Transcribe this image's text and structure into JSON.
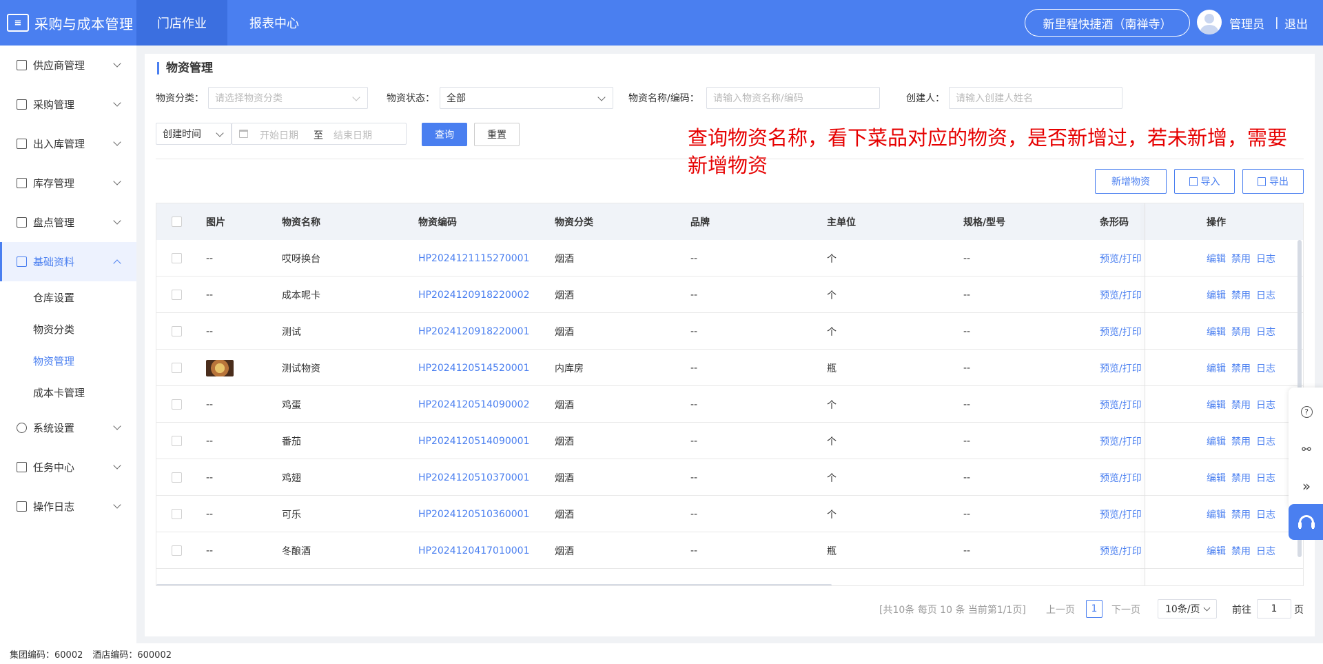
{
  "topbar": {
    "brand_icon": "ticket-logo-icon",
    "brand_title": "采购与成本管理",
    "nav": [
      "门店作业",
      "报表中心"
    ],
    "hotel": "新里程快捷酒（南禅寺）",
    "user": "管理员",
    "separator": "|",
    "logout": "退出",
    "color": "#4a7ff0"
  },
  "sidebar": {
    "items": [
      {
        "label": "供应商管理",
        "icon": "supplier-icon"
      },
      {
        "label": "采购管理",
        "icon": "purchase-icon"
      },
      {
        "label": "出入库管理",
        "icon": "stock-in-out-icon"
      },
      {
        "label": "库存管理",
        "icon": "inventory-icon"
      },
      {
        "label": "盘点管理",
        "icon": "stocktake-icon"
      },
      {
        "label": "基础资料",
        "icon": "basic-data-icon"
      },
      {
        "label": "系统设置",
        "icon": "settings-icon"
      },
      {
        "label": "任务中心",
        "icon": "task-icon"
      },
      {
        "label": "操作日志",
        "icon": "log-icon"
      }
    ],
    "submenu": [
      "仓库设置",
      "物资分类",
      "物资管理",
      "成本卡管理"
    ]
  },
  "page": {
    "title": "物资管理",
    "filters": {
      "category_label": "物资分类：",
      "category_placeholder": "请选择物资分类",
      "status_label": "物资状态：",
      "status_value": "全部",
      "name_label": "物资名称/编码：",
      "name_placeholder": "请输入物资名称/编码",
      "creator_label": "创建人：",
      "creator_placeholder": "请输入创建人姓名",
      "time_type": "创建时间",
      "date_start": "开始日期",
      "date_to": "至",
      "date_end": "结束日期",
      "query": "查询",
      "reset": "重置"
    },
    "annotation": "查询物资名称，看下菜品对应的物资，是否新增过，若未新增，需要新增物资",
    "toolbar": {
      "add": "新增物资",
      "import": "导入",
      "export": "导出"
    }
  },
  "table": {
    "columns": [
      "图片",
      "物资名称",
      "物资编码",
      "物资分类",
      "品牌",
      "主单位",
      "规格/型号",
      "条形码",
      "操作"
    ],
    "rows": [
      {
        "img": "--",
        "name": "哎呀换台",
        "code": "HP2024121115270001",
        "category": "烟酒",
        "brand": "--",
        "unit": "个",
        "spec": "--",
        "barcode": "预览/打印"
      },
      {
        "img": "--",
        "name": "成本呢卡",
        "code": "HP2024120918220002",
        "category": "烟酒",
        "brand": "--",
        "unit": "个",
        "spec": "--",
        "barcode": "预览/打印"
      },
      {
        "img": "--",
        "name": "测试",
        "code": "HP2024120918220001",
        "category": "烟酒",
        "brand": "--",
        "unit": "个",
        "spec": "--",
        "barcode": "预览/打印"
      },
      {
        "img": "",
        "name": "测试物资",
        "code": "HP2024120514520001",
        "category": "内库房",
        "brand": "--",
        "unit": "瓶",
        "spec": "--",
        "barcode": "预览/打印"
      },
      {
        "img": "--",
        "name": "鸡蛋",
        "code": "HP2024120514090002",
        "category": "烟酒",
        "brand": "--",
        "unit": "个",
        "spec": "--",
        "barcode": "预览/打印"
      },
      {
        "img": "--",
        "name": "番茄",
        "code": "HP2024120514090001",
        "category": "烟酒",
        "brand": "--",
        "unit": "个",
        "spec": "--",
        "barcode": "预览/打印"
      },
      {
        "img": "--",
        "name": "鸡翅",
        "code": "HP2024120510370001",
        "category": "烟酒",
        "brand": "--",
        "unit": "个",
        "spec": "--",
        "barcode": "预览/打印"
      },
      {
        "img": "--",
        "name": "可乐",
        "code": "HP2024120510360001",
        "category": "烟酒",
        "brand": "--",
        "unit": "个",
        "spec": "--",
        "barcode": "预览/打印"
      },
      {
        "img": "--",
        "name": "冬酿酒",
        "code": "HP2024120417010001",
        "category": "烟酒",
        "brand": "--",
        "unit": "瓶",
        "spec": "--",
        "barcode": "预览/打印"
      }
    ],
    "ops": [
      "编辑",
      "禁用",
      "日志"
    ]
  },
  "pagination": {
    "summary": "[共10条 每页 10 条 当前第1/1页]",
    "prev": "上一页",
    "current": "1",
    "next": "下一页",
    "page_size": "10条/页",
    "goto_label": "前往",
    "goto_value": "1",
    "page_unit": "页"
  },
  "footer": {
    "group_code": "集团编码：60002",
    "hotel_code": "酒店编码：600002"
  },
  "float_tools": [
    "help-icon",
    "link-icon",
    "collapse-icon",
    "customer-service-icon"
  ]
}
